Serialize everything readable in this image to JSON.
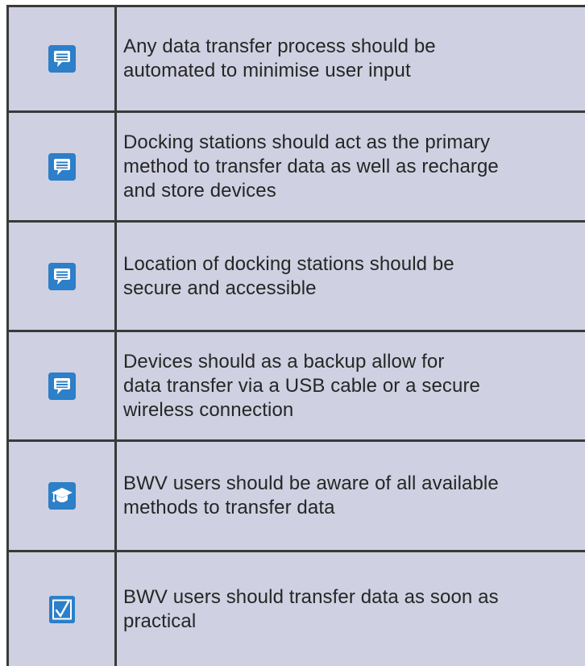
{
  "rows": [
    {
      "icon": "speech-bubble-icon",
      "text": "Any data transfer process should be\nautomated to minimise user input"
    },
    {
      "icon": "speech-bubble-icon",
      "text": "Docking stations should act as the primary\nmethod to transfer data as well as recharge\nand store devices"
    },
    {
      "icon": "speech-bubble-icon",
      "text": "Location of docking stations should be\nsecure and accessible"
    },
    {
      "icon": "speech-bubble-icon",
      "text": "Devices should as a backup allow for\ndata transfer via a USB cable or a secure\nwireless connection"
    },
    {
      "icon": "graduation-cap-icon",
      "text": "BWV users should be aware of all available\nmethods to transfer data"
    },
    {
      "icon": "checkbox-checked-icon",
      "text": "BWV users should transfer data as soon as\npractical"
    }
  ],
  "colors": {
    "row_background": "#cfd0e1",
    "icon_blue": "#2c7fc8",
    "border": "#3a3a3a",
    "text": "#262626"
  }
}
